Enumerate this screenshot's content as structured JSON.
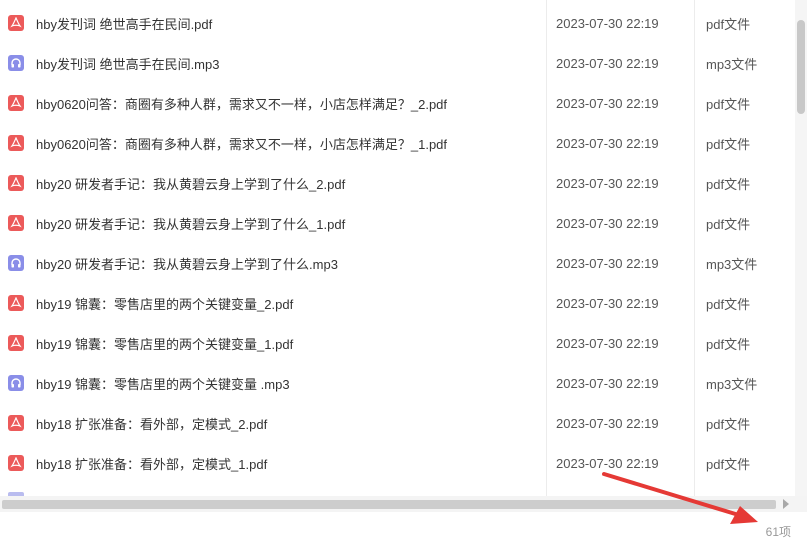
{
  "files": [
    {
      "name": "hby发刊词 绝世高手在民间.pdf",
      "date": "2023-07-30 22:19",
      "type": "pdf文件",
      "icon": "pdf-icon"
    },
    {
      "name": "hby发刊词 绝世高手在民间.mp3",
      "date": "2023-07-30 22:19",
      "type": "mp3文件",
      "icon": "audio-icon"
    },
    {
      "name": "hby0620问答：商圈有多种人群，需求又不一样，小店怎样满足？_2.pdf",
      "date": "2023-07-30 22:19",
      "type": "pdf文件",
      "icon": "pdf-icon"
    },
    {
      "name": "hby0620问答：商圈有多种人群，需求又不一样，小店怎样满足？_1.pdf",
      "date": "2023-07-30 22:19",
      "type": "pdf文件",
      "icon": "pdf-icon"
    },
    {
      "name": "hby20 研发者手记：我从黄碧云身上学到了什么_2.pdf",
      "date": "2023-07-30 22:19",
      "type": "pdf文件",
      "icon": "pdf-icon"
    },
    {
      "name": "hby20 研发者手记：我从黄碧云身上学到了什么_1.pdf",
      "date": "2023-07-30 22:19",
      "type": "pdf文件",
      "icon": "pdf-icon"
    },
    {
      "name": "hby20 研发者手记：我从黄碧云身上学到了什么.mp3",
      "date": "2023-07-30 22:19",
      "type": "mp3文件",
      "icon": "audio-icon"
    },
    {
      "name": "hby19 锦囊：零售店里的两个关键变量_2.pdf",
      "date": "2023-07-30 22:19",
      "type": "pdf文件",
      "icon": "pdf-icon"
    },
    {
      "name": "hby19 锦囊：零售店里的两个关键变量_1.pdf",
      "date": "2023-07-30 22:19",
      "type": "pdf文件",
      "icon": "pdf-icon"
    },
    {
      "name": "hby19 锦囊：零售店里的两个关键变量 .mp3",
      "date": "2023-07-30 22:19",
      "type": "mp3文件",
      "icon": "audio-icon"
    },
    {
      "name": "hby18 扩张准备：看外部，定模式_2.pdf",
      "date": "2023-07-30 22:19",
      "type": "pdf文件",
      "icon": "pdf-icon"
    },
    {
      "name": "hby18 扩张准备：看外部，定模式_1.pdf",
      "date": "2023-07-30 22:19",
      "type": "pdf文件",
      "icon": "pdf-icon"
    }
  ],
  "footer": {
    "count": "61项"
  },
  "colors": {
    "pdf": "#ec5a5a",
    "audio": "#8a8ee8",
    "annotation_arrow": "#e53935"
  }
}
